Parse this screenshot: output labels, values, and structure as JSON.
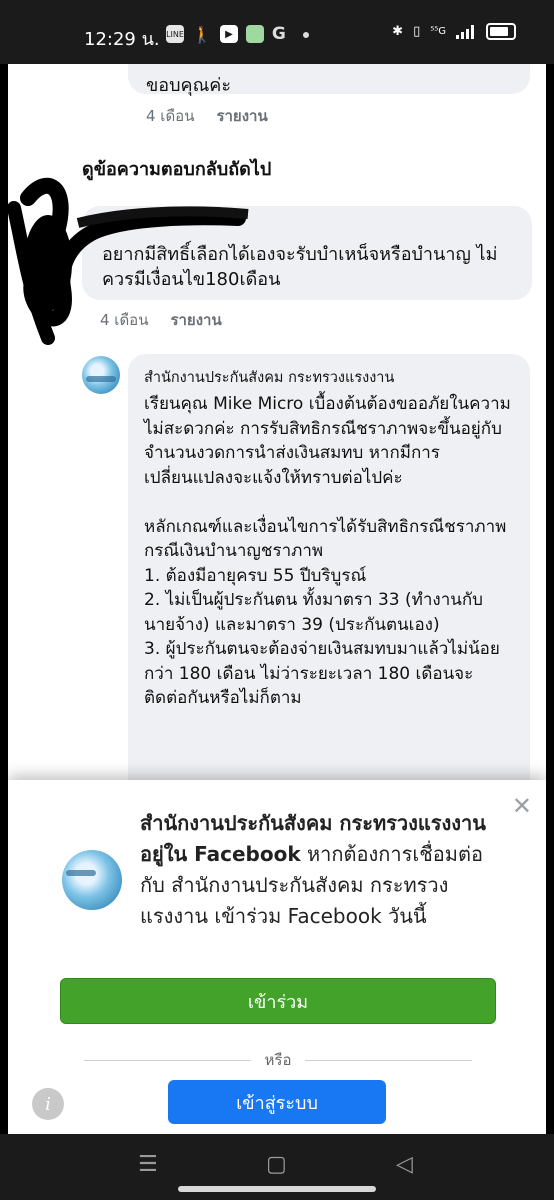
{
  "status_bar": {
    "time": "12:29 น.",
    "network": "⁵⁵G",
    "icons": [
      "line-app-icon",
      "walking-icon",
      "youtube-icon",
      "messages-icon",
      "google-icon",
      "bluetooth-icon",
      "vibrate-icon",
      "signal-icon",
      "battery-icon"
    ]
  },
  "comments": [
    {
      "text": "ขอบคุณค่ะ",
      "time": "4 เดือน",
      "report": "รายงาน"
    }
  ],
  "see_more_replies": "ดูข้อความตอบกลับถัดไป",
  "user_comment": {
    "text": "อยากมีสิทธิ์เลือกได้เองจะรับบำเหน็จหรือบำนาญ ไม่ควรมีเงื่อนไข180เดือน",
    "time": "4 เดือน",
    "report": "รายงาน"
  },
  "page_reply": {
    "author": "สำนักงานประกันสังคม กระทรวงแรงงาน",
    "body": "เรียนคุณ Mike Micro เบื้องต้นต้องขออภัยในความไม่สะดวกค่ะ การรับสิทธิกรณีชราภาพจะขึ้นอยู่กับจำนวนงวดการนำส่งเงินสมทบ หากมีการเปลี่ยนแปลงจะแจ้งให้ทราบต่อไปค่ะ\n\nหลักเกณฑ์และเงื่อนไขการได้รับสิทธิกรณีชราภาพ\nกรณีเงินบำนาญชราภาพ\n1. ต้องมีอายุครบ 55 ปีบริบูรณ์\n2. ไม่เป็นผู้ประกันตน ทั้งมาตรา 33 (ทำงานกับนายจ้าง) และมาตรา 39 (ประกันตนเอง)\n3. ผู้ประกันตนจะต้องจ่ายเงินสมทบมาแล้วไม่น้อยกว่า 180 เดือน ไม่ว่าระยะเวลา 180 เดือนจะติดต่อกันหรือไม่ก็ตาม"
  },
  "login_prompt": {
    "page_name": "สำนักงานประกันสังคม กระทรวงแรงงาน อยู่ใน Facebook",
    "message": " หากต้องการเชื่อมต่อกับ สำนักงานประกันสังคม กระทรวงแรงงาน เข้าร่วม Facebook วันนี้",
    "join_label": "เข้าร่วม",
    "or_label": "หรือ",
    "login_label": "เข้าสู่ระบบ",
    "info_label": "i",
    "close_label": "✕"
  },
  "nav": {
    "recent_icon": "☰",
    "home_icon": "▢",
    "back_icon": "◁"
  },
  "colors": {
    "join_button": "#42a229",
    "login_button": "#1877f2",
    "bubble": "#eef0f3"
  }
}
